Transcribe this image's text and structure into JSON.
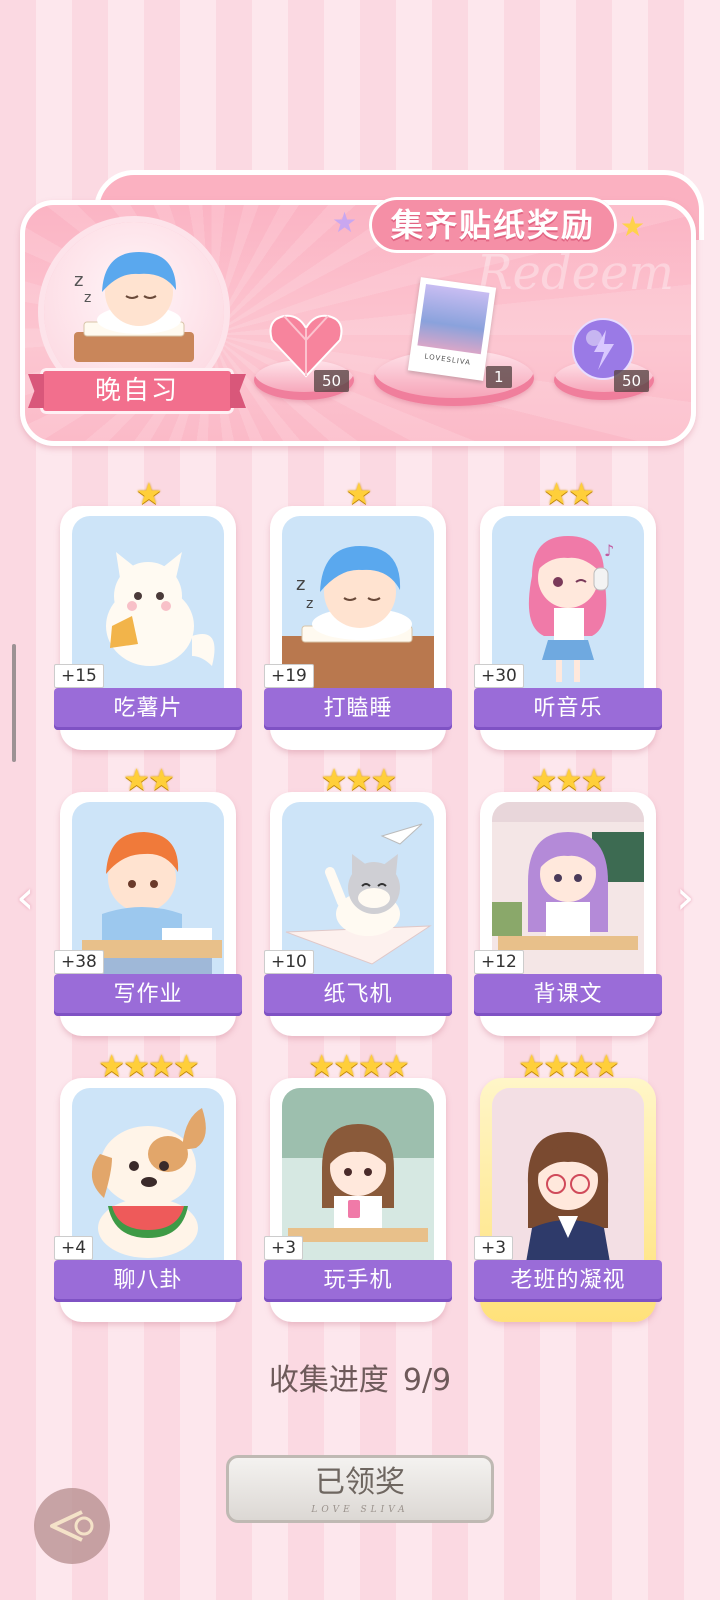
{
  "banner": {
    "title": "集齐贴纸奖励",
    "ghost_text": "Redeem",
    "featured_sticker": "晚自习",
    "rewards": [
      {
        "item": "heart-gem",
        "count": "50"
      },
      {
        "item": "photo-card",
        "count": "1",
        "caption": "LOVESLIVA"
      },
      {
        "item": "energy-orb",
        "count": "50"
      }
    ]
  },
  "stickers": [
    {
      "name": "吃薯片",
      "bonus": "+15",
      "stars": "★"
    },
    {
      "name": "打瞌睡",
      "bonus": "+19",
      "stars": "★"
    },
    {
      "name": "听音乐",
      "bonus": "+30",
      "stars": "★★"
    },
    {
      "name": "写作业",
      "bonus": "+38",
      "stars": "★★"
    },
    {
      "name": "纸飞机",
      "bonus": "+10",
      "stars": "★★★"
    },
    {
      "name": "背课文",
      "bonus": "+12",
      "stars": "★★★"
    },
    {
      "name": "聊八卦",
      "bonus": "+4",
      "stars": "★★★★"
    },
    {
      "name": "玩手机",
      "bonus": "+3",
      "stars": "★★★★"
    },
    {
      "name": "老班的凝视",
      "bonus": "+3",
      "stars": "★★★★"
    }
  ],
  "progress": {
    "label": "收集进度",
    "value": "9/9"
  },
  "claim_button": {
    "label": "已领奖",
    "sub": "LOVE SLIVA"
  },
  "nav": {
    "left_arrow": "‹",
    "right_arrow": "›"
  },
  "colors": {
    "label_purple": "#9a6cd8",
    "banner_pink": "#fbb4c4",
    "star_gold": "#ffcf3a"
  }
}
